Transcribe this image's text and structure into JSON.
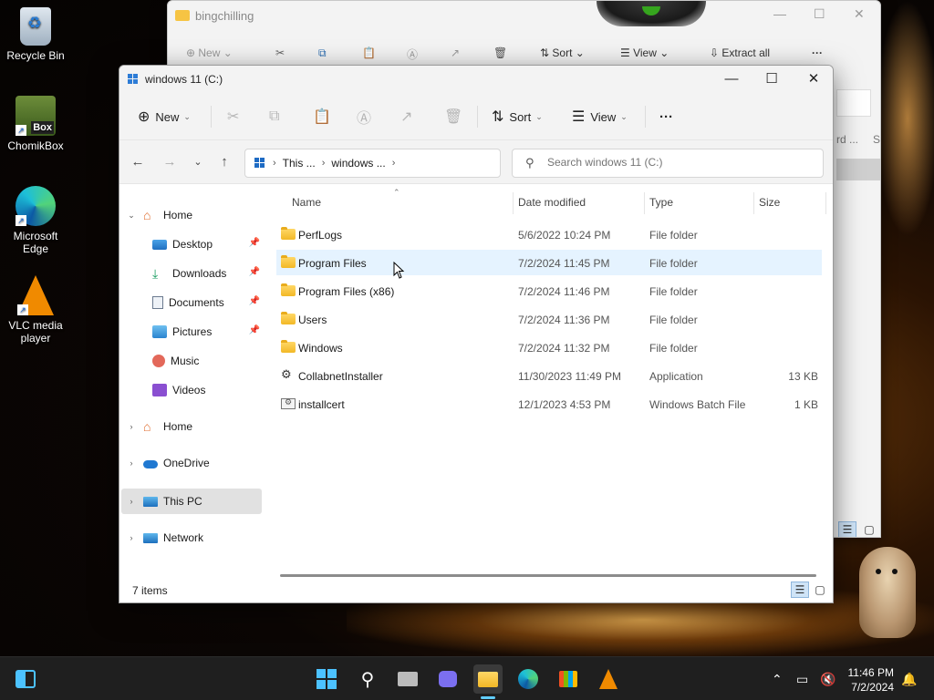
{
  "desktop": {
    "icons": [
      {
        "label": "Recycle Bin"
      },
      {
        "label": "ChomikBox"
      },
      {
        "label": "Microsoft Edge"
      },
      {
        "label": "VLC media player"
      }
    ]
  },
  "back_window": {
    "title": "bingchilling",
    "toolbar": {
      "new": "New",
      "sort": "Sort",
      "view": "View",
      "extract_all": "Extract all"
    },
    "columns_partial": [
      "rd ...",
      "Si"
    ]
  },
  "window": {
    "title": "windows 11 (C:)",
    "toolbar": {
      "new": "New",
      "sort": "Sort",
      "view": "View",
      "more": "···"
    },
    "address": {
      "crumbs": [
        "This ...",
        "windows ..."
      ]
    },
    "search": {
      "placeholder": "Search windows 11 (C:)"
    },
    "sidebar": {
      "items": [
        {
          "label": "Home"
        },
        {
          "label": "Desktop"
        },
        {
          "label": "Downloads"
        },
        {
          "label": "Documents"
        },
        {
          "label": "Pictures"
        },
        {
          "label": "Music"
        },
        {
          "label": "Videos"
        },
        {
          "label": "Home"
        },
        {
          "label": "OneDrive"
        },
        {
          "label": "This PC"
        },
        {
          "label": "Network"
        }
      ]
    },
    "columns": {
      "name": "Name",
      "date": "Date modified",
      "type": "Type",
      "size": "Size"
    },
    "files": [
      {
        "name": "PerfLogs",
        "date": "5/6/2022 10:24 PM",
        "type": "File folder",
        "size": ""
      },
      {
        "name": "Program Files",
        "date": "7/2/2024 11:45 PM",
        "type": "File folder",
        "size": ""
      },
      {
        "name": "Program Files (x86)",
        "date": "7/2/2024 11:46 PM",
        "type": "File folder",
        "size": ""
      },
      {
        "name": "Users",
        "date": "7/2/2024 11:36 PM",
        "type": "File folder",
        "size": ""
      },
      {
        "name": "Windows",
        "date": "7/2/2024 11:32 PM",
        "type": "File folder",
        "size": ""
      },
      {
        "name": "CollabnetInstaller",
        "date": "11/30/2023 11:49 PM",
        "type": "Application",
        "size": "13 KB"
      },
      {
        "name": "installcert",
        "date": "12/1/2023 4:53 PM",
        "type": "Windows Batch File",
        "size": "1 KB"
      }
    ],
    "status": "7 items"
  },
  "taskbar": {
    "time": "11:46 PM",
    "date": "7/2/2024"
  },
  "colors": {
    "accent": "#60cdff",
    "hover_row": "#e5f3ff",
    "folder": "#f6c443"
  }
}
